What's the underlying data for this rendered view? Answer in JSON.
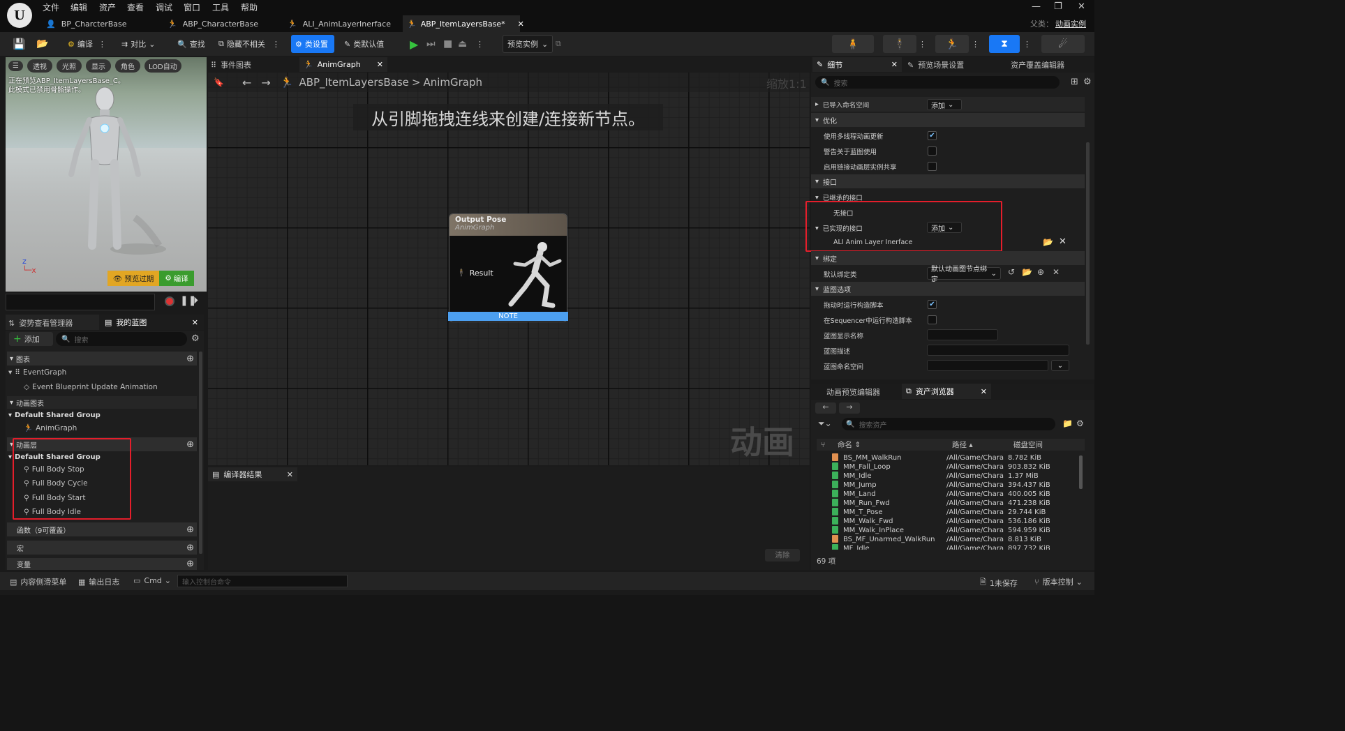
{
  "title_menu": [
    "文件",
    "编辑",
    "资产",
    "查看",
    "调试",
    "窗口",
    "工具",
    "帮助"
  ],
  "tabs": [
    "BP_CharcterBase",
    "ABP_CharacterBase",
    "ALI_AnimLayerInerface",
    "ABP_ItemLayersBase*"
  ],
  "parent_label": "父类：",
  "parent_value": "动画实例",
  "logo": "U",
  "toolbar": {
    "compile": "编译",
    "diff": "对比",
    "find": "查找",
    "hide_unrelated": "隐藏不相关",
    "class_settings": "类设置",
    "class_defaults": "类默认值",
    "preview_instance": "预览实例"
  },
  "viewport": {
    "perspective": "透视",
    "lit": "光照",
    "show": "显示",
    "character": "角色",
    "lod": "LOD自动",
    "notice_line1": "正在预览ABP_ItemLayersBase_C。",
    "notice_line2": "此模式已禁用骨骼操作。",
    "preview_outdated": "预览过期",
    "compile": "编译"
  },
  "left_tabs": {
    "pose_watch": "姿势查看管理器",
    "my_blueprint": "我的蓝图"
  },
  "my_blueprint": {
    "add": "添加",
    "search_placeholder": "搜索",
    "graphs": "图表",
    "event_graph": "EventGraph",
    "event_update": "Event Blueprint Update Animation",
    "anim_graphs": "动画图表",
    "default_group": "Default Shared Group",
    "anim_graph": "AnimGraph",
    "anim_layers": "动画层",
    "default_group2": "Default Shared Group",
    "layers": [
      "Full Body Stop",
      "Full Body Cycle",
      "Full Body Start",
      "Full Body Idle"
    ],
    "functions": "函数（9可覆盖）",
    "macros": "宏",
    "variables": "变量"
  },
  "graph": {
    "tab_event": "事件图表",
    "tab_anim": "AnimGraph",
    "breadcrumb_bp": "ABP_ItemLayersBase",
    "breadcrumb_sep": ">",
    "breadcrumb_graph": "AnimGraph",
    "zoom": "缩放1:1",
    "hint": "从引脚拖拽连线来创建/连接新节点。",
    "watermark": "动画",
    "node_title": "Output Pose",
    "node_subtitle": "AnimGraph",
    "node_pin": "Result",
    "node_note": "NOTE"
  },
  "compiler": {
    "tab": "编译器结果",
    "clear": "清除"
  },
  "details": {
    "tab_details": "细节",
    "tab_preview": "预览场景设置",
    "tab_override": "资产覆盖编辑器",
    "search_placeholder": "搜索",
    "imported_ns": "已导入命名空间",
    "add": "添加",
    "optimization": "优化",
    "use_multithread": "使用多线程动画更新",
    "warn_bp_usage": "警告关于蓝图使用",
    "enable_linked_share": "启用链接动画层实例共享",
    "interfaces": "接口",
    "inherited": "已继承的接口",
    "no_interface": "无接口",
    "implemented": "已实现的接口",
    "add2": "添加",
    "ali_name": "ALI Anim Layer Inerface",
    "binding": "绑定",
    "default_binding": "默认绑定类",
    "binding_value": "默认动画图节点绑定",
    "bp_options": "蓝图选项",
    "run_construct_drag": "拖动时运行构造脚本",
    "run_construct_seq": "在Sequencer中运行构造脚本",
    "display_name": "蓝图显示名称",
    "description": "蓝图描述",
    "namespace": "蓝图命名空间"
  },
  "checks": {
    "use_multithread": true,
    "warn_bp_usage": false,
    "enable_linked_share": false,
    "run_construct_drag": true,
    "run_construct_seq": false
  },
  "asset_browser": {
    "tab_anim_preview": "动画预览编辑器",
    "tab_assets": "资产浏览器",
    "search_placeholder": "搜索资产",
    "col_name": "命名",
    "col_path": "路径",
    "col_size": "磁盘空间",
    "count": "69 项",
    "rows": [
      {
        "name": "BS_MM_WalkRun",
        "path": "/All/Game/Chara",
        "size": "8.782 KiB",
        "kind": "blendspace"
      },
      {
        "name": "MM_Fall_Loop",
        "path": "/All/Game/Chara",
        "size": "903.832 KiB",
        "kind": "anim"
      },
      {
        "name": "MM_Idle",
        "path": "/All/Game/Chara",
        "size": "1.37 MiB",
        "kind": "anim"
      },
      {
        "name": "MM_Jump",
        "path": "/All/Game/Chara",
        "size": "394.437 KiB",
        "kind": "anim"
      },
      {
        "name": "MM_Land",
        "path": "/All/Game/Chara",
        "size": "400.005 KiB",
        "kind": "anim"
      },
      {
        "name": "MM_Run_Fwd",
        "path": "/All/Game/Chara",
        "size": "471.238 KiB",
        "kind": "anim"
      },
      {
        "name": "MM_T_Pose",
        "path": "/All/Game/Chara",
        "size": "29.744 KiB",
        "kind": "anim"
      },
      {
        "name": "MM_Walk_Fwd",
        "path": "/All/Game/Chara",
        "size": "536.186 KiB",
        "kind": "anim"
      },
      {
        "name": "MM_Walk_InPlace",
        "path": "/All/Game/Chara",
        "size": "594.959 KiB",
        "kind": "anim"
      },
      {
        "name": "BS_MF_Unarmed_WalkRun",
        "path": "/All/Game/Chara",
        "size": "8.813 KiB",
        "kind": "blendspace"
      },
      {
        "name": "MF_Idle",
        "path": "/All/Game/Chara",
        "size": "897.732 KiB",
        "kind": "anim"
      }
    ]
  },
  "statusbar": {
    "content_drawer": "内容侧滑菜单",
    "output_log": "输出日志",
    "cmd": "Cmd",
    "console_placeholder": "输入控制台命令",
    "unsaved": "1未保存",
    "source_control": "版本控制"
  },
  "colors": {
    "accent": "#1978f5",
    "highlight_box": "#e41e2b",
    "play": "#36c23e",
    "blendspace_icon": "#e09050",
    "anim_icon": "#3cb05a"
  }
}
